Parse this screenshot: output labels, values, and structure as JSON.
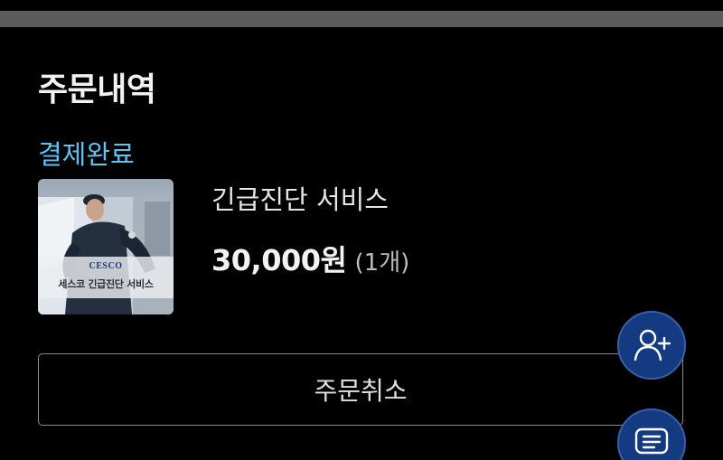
{
  "order": {
    "section_title": "주문내역",
    "status": "결제완료",
    "item": {
      "thumbnail": {
        "logo_text": "CESCO",
        "caption": "세스코 긴급진단 서비스"
      },
      "name": "긴급진단 서비스",
      "price": "30,000원",
      "quantity": "(1개)"
    },
    "cancel_label": "주문취소"
  },
  "floating_buttons": [
    {
      "icon": "add-user-icon"
    },
    {
      "icon": "chat-icon"
    }
  ],
  "colors": {
    "background": "#000000",
    "status_accent": "#5ec3f2",
    "fab_bg": "#143a82"
  }
}
